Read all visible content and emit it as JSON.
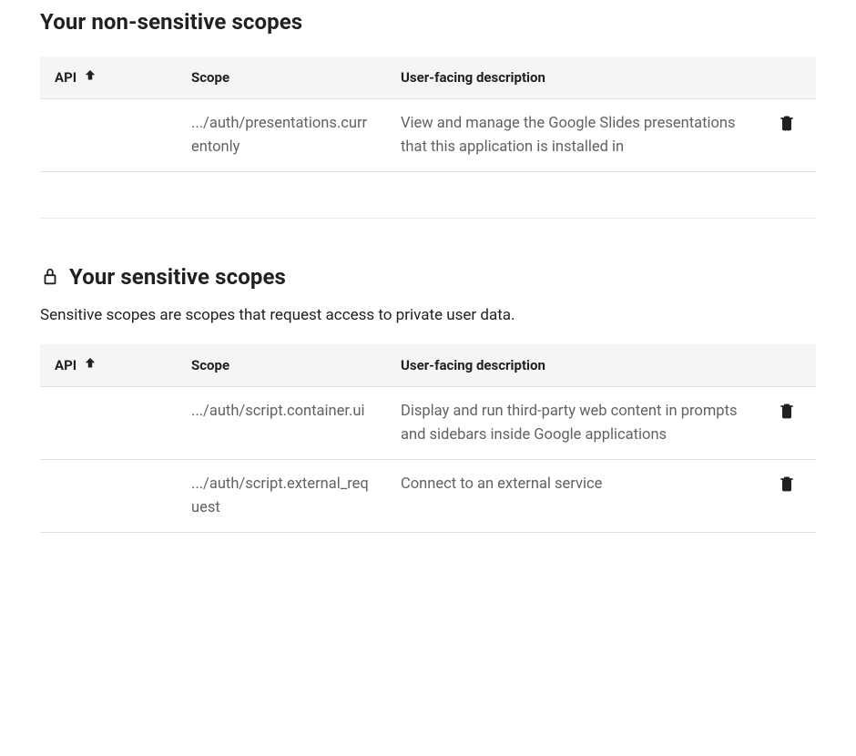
{
  "sections": {
    "non_sensitive": {
      "title": "Your non-sensitive scopes",
      "columns": {
        "api": "API",
        "scope": "Scope",
        "desc": "User-facing description"
      },
      "rows": [
        {
          "api": "",
          "scope": ".../auth/presentations.currentonly",
          "desc": "View and manage the Google Slides presentations that this application is installed in"
        }
      ]
    },
    "sensitive": {
      "title": "Your sensitive scopes",
      "subtitle": "Sensitive scopes are scopes that request access to private user data.",
      "columns": {
        "api": "API",
        "scope": "Scope",
        "desc": "User-facing description"
      },
      "rows": [
        {
          "api": "",
          "scope": ".../auth/script.container.ui",
          "desc": "Display and run third-party web content in prompts and sidebars inside Google applications"
        },
        {
          "api": "",
          "scope": ".../auth/script.external_request",
          "desc": "Connect to an external service"
        }
      ]
    }
  }
}
